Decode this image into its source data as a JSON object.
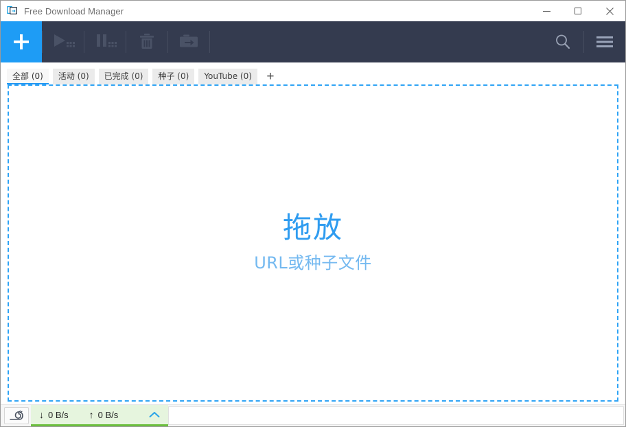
{
  "window": {
    "title": "Free Download Manager",
    "app_icon": "fdm-download-icon",
    "controls": {
      "minimize": "minimize-icon",
      "maximize": "maximize-icon",
      "close": "close-icon"
    }
  },
  "toolbar": {
    "add_label": "add-icon",
    "buttons": [
      {
        "name": "resume-all-button",
        "icon": "play-all-icon"
      },
      {
        "name": "pause-all-button",
        "icon": "pause-all-icon"
      },
      {
        "name": "delete-button",
        "icon": "trash-icon"
      },
      {
        "name": "move-to-folder-button",
        "icon": "folder-arrow-icon"
      }
    ],
    "search_icon": "search-icon",
    "menu_icon": "hamburger-menu-icon"
  },
  "tabs": {
    "items": [
      {
        "label": "全部 (0)",
        "active": true
      },
      {
        "label": "活动 (0)",
        "active": false
      },
      {
        "label": "已完成 (0)",
        "active": false
      },
      {
        "label": "种子 (0)",
        "active": false
      },
      {
        "label": "YouTube (0)",
        "active": false
      }
    ],
    "add_label": "+"
  },
  "dropzone": {
    "title": "拖放",
    "subtitle": "URL或种子文件"
  },
  "statusbar": {
    "speed_limit_icon": "snail-icon",
    "download_arrow": "↓",
    "download_speed": "0 B/s",
    "upload_arrow": "↑",
    "upload_speed": "0 B/s",
    "expand_icon": "chevron-up-icon"
  },
  "colors": {
    "accent_blue": "#1e9cf5",
    "toolbar_dark": "#343b4f",
    "tab_active_underline": "#2196f3",
    "dropzone_border": "#2fa4f5",
    "dropzone_title": "#2f9cf0",
    "dropzone_subtitle": "#74b9f0",
    "speed_panel_bg": "#e6f5de",
    "speed_panel_border": "#6cbf3e"
  }
}
